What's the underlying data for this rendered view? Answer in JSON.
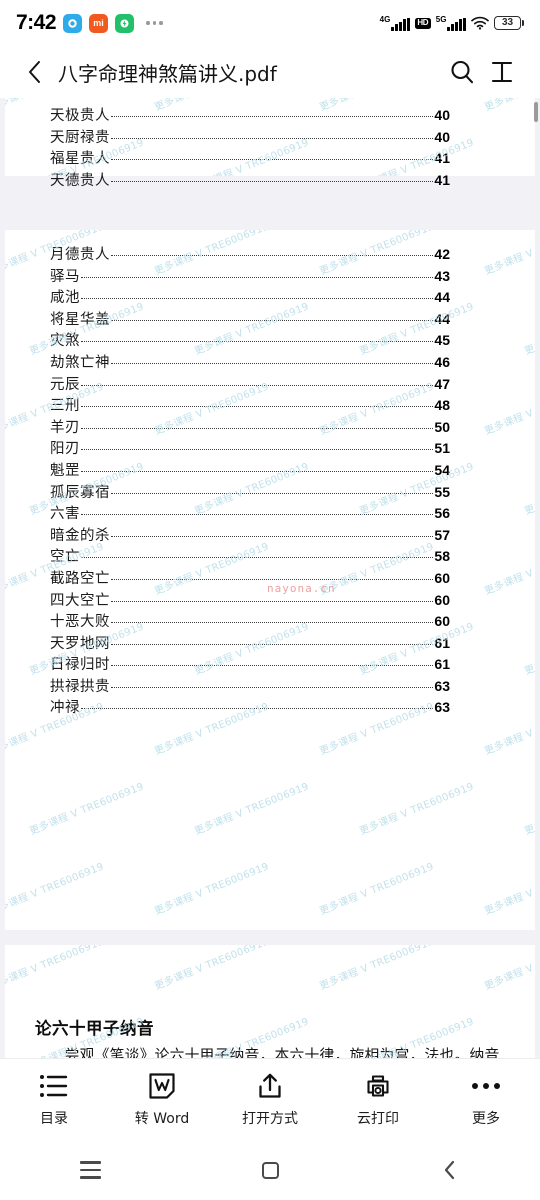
{
  "statusbar": {
    "time": "7:42",
    "app_icons": [
      {
        "name": "messenger-icon",
        "glyph": "●",
        "color": "#2eabe8"
      },
      {
        "name": "mi-app-icon",
        "glyph": "mi",
        "color": "#f0591f"
      },
      {
        "name": "green-app-icon",
        "glyph": "◑",
        "color": "#23c06b"
      }
    ],
    "overflow_dots": "•••",
    "network_1": "4G",
    "hd_badge": "HD",
    "network_2": "5G",
    "wifi": "wifi-icon",
    "battery_level": "33"
  },
  "titlebar": {
    "back": "‹",
    "title": "八字命理神煞篇讲义.pdf",
    "search": "search-icon",
    "reflow": "fit-width-icon"
  },
  "document": {
    "watermark_text": "更多课程 V TRE6006919",
    "watermark_red": "nayona.cn",
    "page1_toc": [
      {
        "title": "天极贵人",
        "page": "40"
      },
      {
        "title": "天厨禄贵",
        "page": "40"
      },
      {
        "title": "福星贵人",
        "page": "41"
      },
      {
        "title": "天德贵人",
        "page": "41"
      }
    ],
    "page2_toc": [
      {
        "title": "月德贵人",
        "page": "42"
      },
      {
        "title": "驿马",
        "page": "43"
      },
      {
        "title": "咸池",
        "page": "44"
      },
      {
        "title": "将星华盖",
        "page": "44"
      },
      {
        "title": "灾煞",
        "page": "45"
      },
      {
        "title": "劫煞亡神",
        "page": "46"
      },
      {
        "title": "元辰",
        "page": "47"
      },
      {
        "title": "三刑",
        "page": "48"
      },
      {
        "title": "羊刃",
        "page": "50"
      },
      {
        "title": "阳刃",
        "page": "51"
      },
      {
        "title": "魁罡",
        "page": "54"
      },
      {
        "title": "孤辰寡宿",
        "page": "55"
      },
      {
        "title": "六害",
        "page": "56"
      },
      {
        "title": "暗金的杀",
        "page": "57"
      },
      {
        "title": "空亡",
        "page": "58"
      },
      {
        "title": "截路空亡",
        "page": "60"
      },
      {
        "title": "四大空亡",
        "page": "60"
      },
      {
        "title": "十恶大败",
        "page": "60"
      },
      {
        "title": "天罗地网",
        "page": "61"
      },
      {
        "title": "日禄归时",
        "page": "61"
      },
      {
        "title": "拱禄拱贵",
        "page": "63"
      },
      {
        "title": "冲禄",
        "page": "63"
      }
    ],
    "page3_heading": "论六十甲子纳音",
    "page3_paragraph": "尝观《笔谈》论六十甲子纳音，本六十律，旋相为宫，法也。纳音"
  },
  "toolbar": [
    {
      "label": "目录",
      "icon": "list-icon"
    },
    {
      "label": "转 Word",
      "icon": "word-doc-icon"
    },
    {
      "label": "打开方式",
      "icon": "share-upload-icon"
    },
    {
      "label": "云打印",
      "icon": "cloud-print-icon"
    },
    {
      "label": "更多",
      "icon": "more-dots-icon"
    }
  ],
  "navbar": {
    "recents": "recents-icon",
    "home": "home-icon",
    "back": "back-icon"
  }
}
